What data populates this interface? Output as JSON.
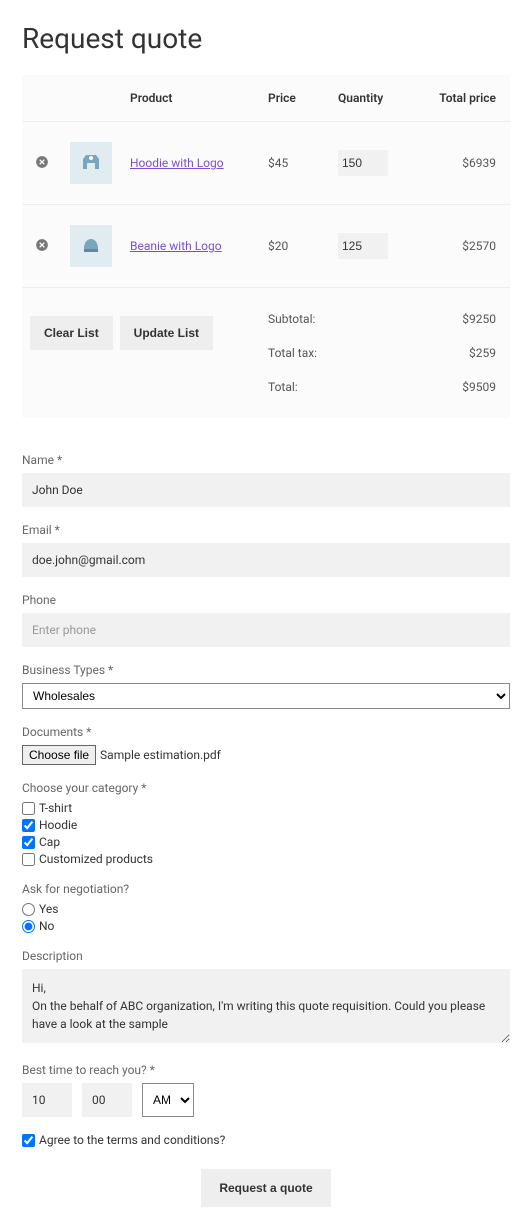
{
  "page": {
    "title": "Request quote"
  },
  "table": {
    "headers": {
      "product": "Product",
      "price": "Price",
      "quantity": "Quantity",
      "total": "Total price"
    },
    "rows": [
      {
        "name": "Hoodie with Logo",
        "price": "$45",
        "qty": "150",
        "total": "$6939",
        "thumb": "hoodie"
      },
      {
        "name": "Beanie with Logo",
        "price": "$20",
        "qty": "125",
        "total": "$2570",
        "thumb": "beanie"
      }
    ],
    "actions": {
      "clear": "Clear List",
      "update": "Update List"
    },
    "totals": {
      "subtotal_label": "Subtotal:",
      "subtotal_value": "$9250",
      "tax_label": "Total tax:",
      "tax_value": "$259",
      "total_label": "Total:",
      "total_value": "$9509"
    }
  },
  "form": {
    "name": {
      "label": "Name *",
      "value": "John Doe"
    },
    "email": {
      "label": "Email *",
      "value": "doe.john@gmail.com"
    },
    "phone": {
      "label": "Phone",
      "placeholder": "Enter phone"
    },
    "business": {
      "label": "Business Types *",
      "value": "Wholesales"
    },
    "documents": {
      "label": "Documents *",
      "button": "Choose file",
      "filename": "Sample estimation.pdf"
    },
    "category": {
      "label": "Choose your category *",
      "options": [
        {
          "label": "T-shirt",
          "checked": false
        },
        {
          "label": "Hoodie",
          "checked": true
        },
        {
          "label": "Cap",
          "checked": true
        },
        {
          "label": "Customized products",
          "checked": false
        }
      ]
    },
    "negotiation": {
      "label": "Ask for negotiation?",
      "options": [
        {
          "label": "Yes",
          "checked": false
        },
        {
          "label": "No",
          "checked": true
        }
      ]
    },
    "description": {
      "label": "Description",
      "value": "Hi,\nOn the behalf of ABC organization, I'm writing this quote requisition. Could you please have a look at the sample"
    },
    "reach": {
      "label": "Best time to reach you? *",
      "hour": "10",
      "minute": "00",
      "period": "AM"
    },
    "agree": {
      "label": "Agree to the terms and conditions?",
      "checked": true
    },
    "submit": "Request a quote"
  }
}
